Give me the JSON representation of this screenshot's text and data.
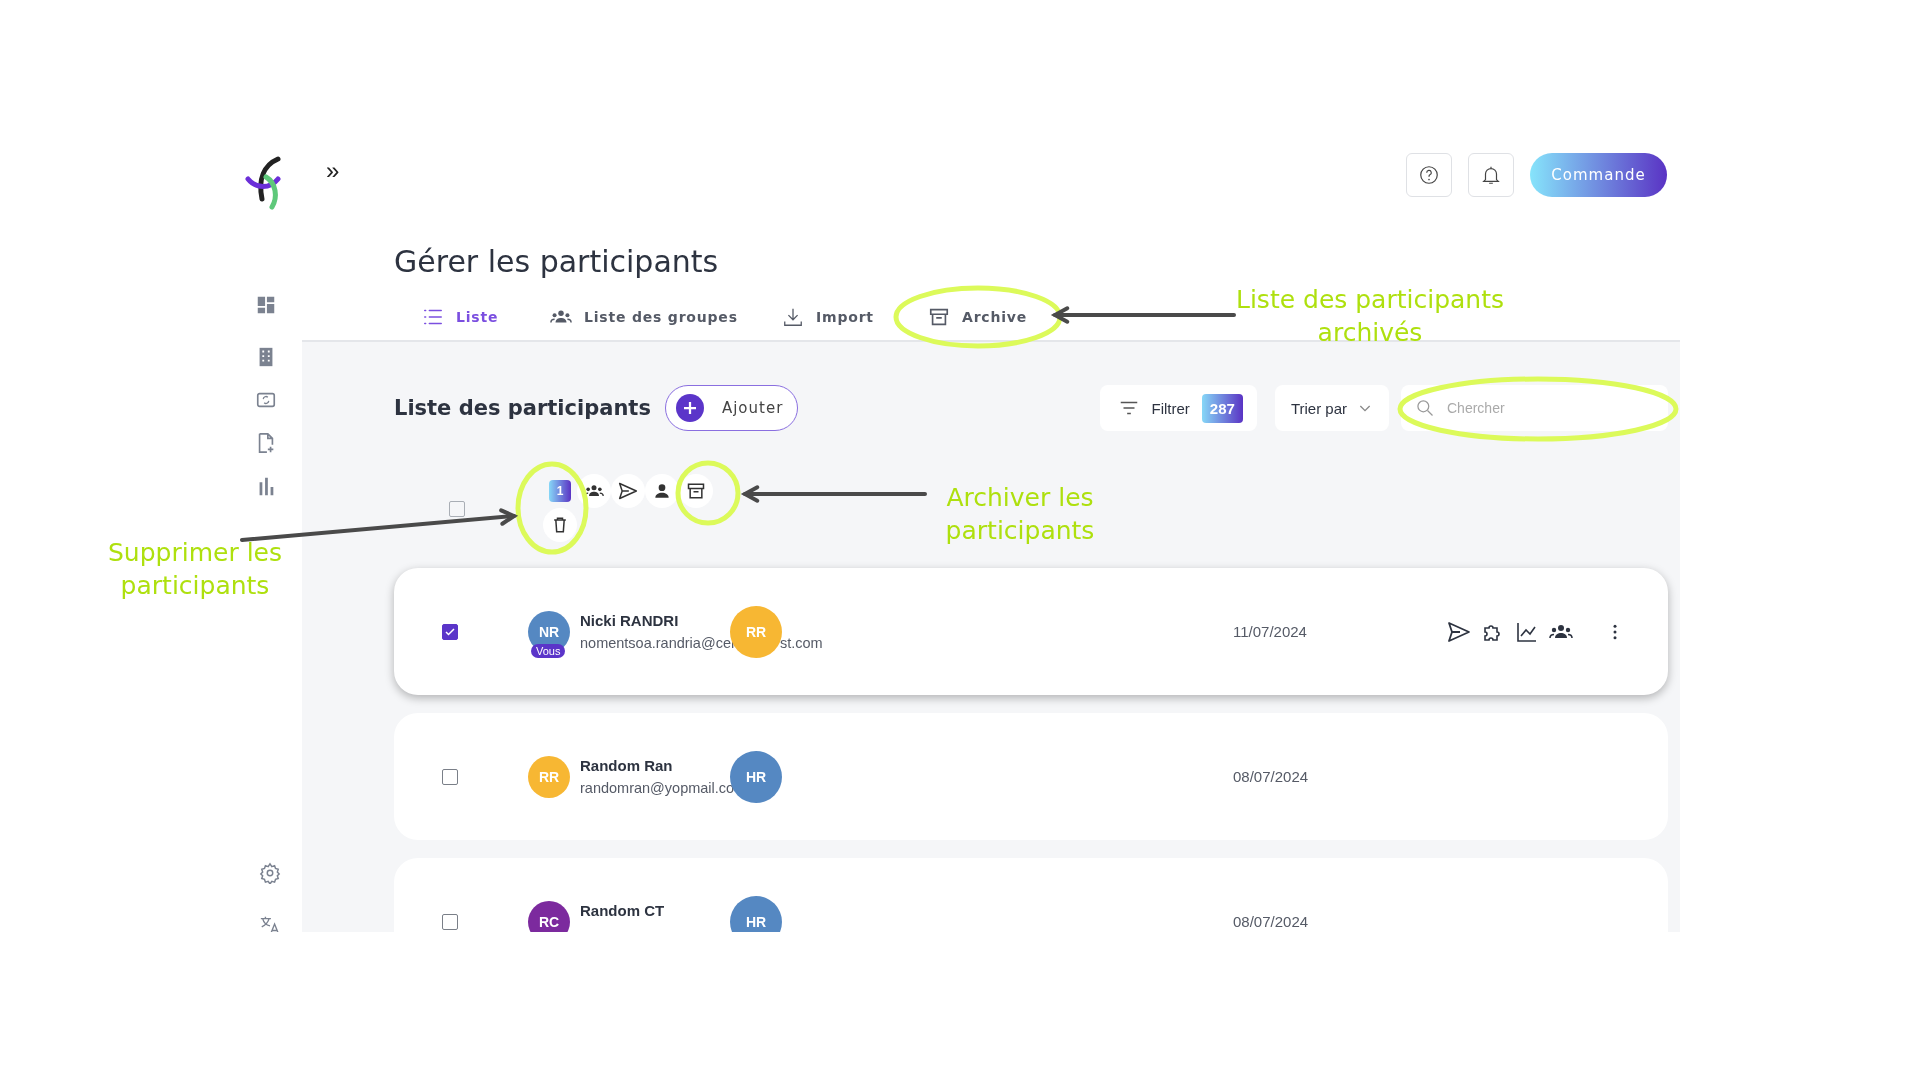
{
  "header": {
    "expand_toggle": "»",
    "order_button": "Commande"
  },
  "page_title": "Gérer les participants",
  "tabs": [
    {
      "label": "Liste",
      "selected": true
    },
    {
      "label": "Liste des groupes",
      "selected": false
    },
    {
      "label": "Import",
      "selected": false
    },
    {
      "label": "Archive",
      "selected": false
    }
  ],
  "list": {
    "title": "Liste des participants",
    "add_button": "Ajouter",
    "filter": {
      "label": "Filtrer",
      "count": "287"
    },
    "sort": {
      "label": "Trier par"
    },
    "search": {
      "placeholder": "Chercher"
    }
  },
  "bulk_actions": {
    "select_all_checked": false,
    "selected_count": "1"
  },
  "rows": [
    {
      "checked": true,
      "highlighted": true,
      "initials": "NR",
      "color": "#5588c2",
      "you_badge": "Vous",
      "name": "Nicki RANDRI",
      "email": "nomentsoa.randria@cer",
      "email_after": "st.com",
      "manager": {
        "initials": "RR",
        "color": "#f7b733"
      },
      "date": "11/07/2024"
    },
    {
      "checked": false,
      "highlighted": false,
      "initials": "RR",
      "color": "#f7b733",
      "name": "Random Ran",
      "email": "randomran@yopmail.co",
      "manager": {
        "initials": "HR",
        "color": "#5588c2"
      },
      "date": "08/07/2024"
    },
    {
      "checked": false,
      "highlighted": false,
      "initials": "RC",
      "color": "#7c2a9e",
      "name": "Random CT",
      "manager": {
        "initials": "HR",
        "color": "#5588c2"
      },
      "date": "08/07/2024"
    }
  ],
  "annotations": [
    {
      "text": "Liste des participants archivés"
    },
    {
      "text": "Archiver les participants"
    },
    {
      "text": "Supprimer les participants"
    }
  ]
}
